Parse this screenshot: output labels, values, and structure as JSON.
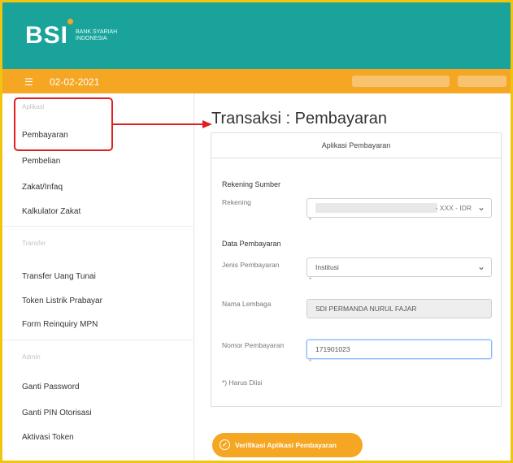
{
  "brand": {
    "logo_text": "BSI",
    "logo_sub": "BANK SYARIAH INDONESIA"
  },
  "datebar": {
    "date": "02-02-2021"
  },
  "sidebar": {
    "group1": "Aplikasi",
    "items1": [
      "Pembayaran",
      "Pembelian",
      "Zakat/Infaq",
      "Kalkulator Zakat"
    ],
    "group2": "Transfer",
    "items2": [
      "Transfer Uang Tunai",
      "Token Listrik Prabayar",
      "Form Reinquiry MPN"
    ],
    "group3": "Admin",
    "items3": [
      "Ganti Password",
      "Ganti PIN Otorisasi",
      "Aktivasi Token"
    ]
  },
  "main": {
    "title": "Transaksi : Pembayaran",
    "card_title": "Aplikasi Pembayaran",
    "section_rekening": "Rekening Sumber",
    "label_rekening": "Rekening",
    "rekening_suffix": "- XXX - IDR",
    "section_data": "Data Pembayaran",
    "label_jenis": "Jenis Pembayaran",
    "jenis_value": "Institusi",
    "label_nama": "Nama Lembaga",
    "nama_value": "SDI PERMANDA NURUL FAJAR",
    "label_nomor": "Nomor Pembayaran",
    "nomor_value": "171901023",
    "note": "*) Harus Diisi",
    "cta": "Verifikasi Aplikasi Pembayaran"
  },
  "colors": {
    "teal": "#1aa39a",
    "orange": "#f5a623",
    "annotation_red": "#e02020",
    "frame_yellow": "#f1c40f"
  },
  "icons": {
    "menu": "hamburger-icon",
    "chevron": "chevron-down-icon",
    "cta": "check-circle-icon"
  }
}
